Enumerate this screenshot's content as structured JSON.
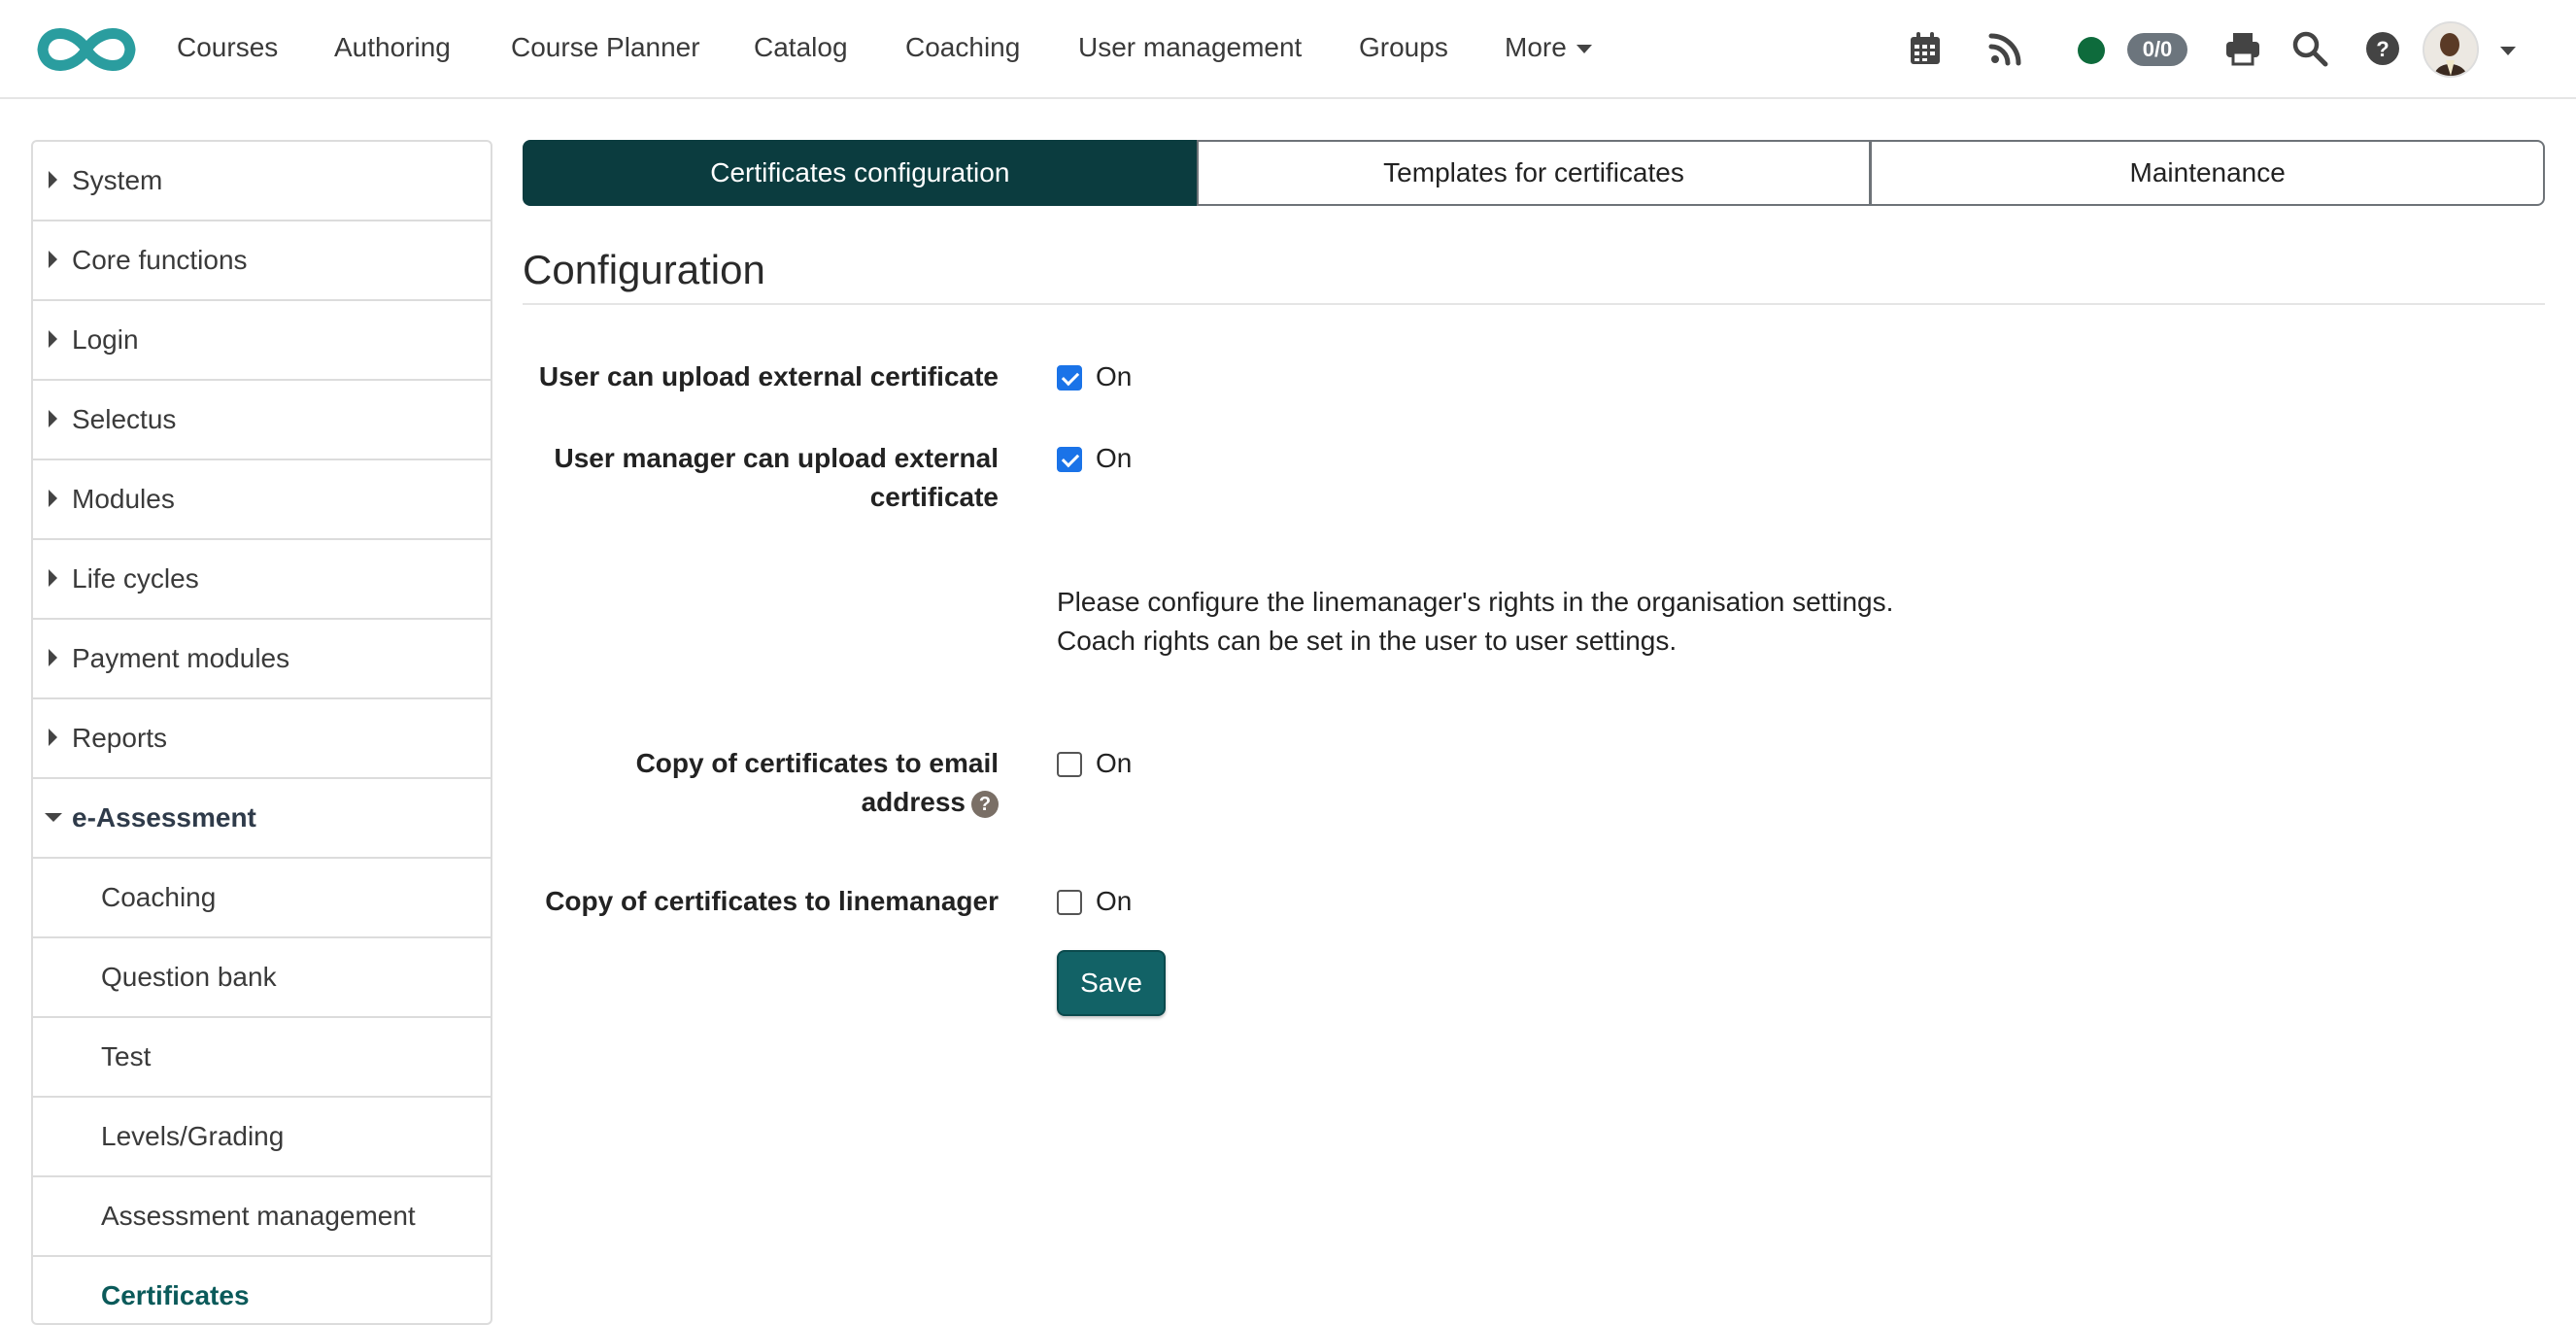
{
  "navbar": {
    "items": [
      "Courses",
      "Authoring",
      "Course Planner",
      "Catalog",
      "Coaching",
      "User management",
      "Groups",
      "More"
    ],
    "badge": "0/0",
    "icons": [
      "calendar-icon",
      "rss-icon",
      "status-dot",
      "print-icon",
      "search-icon",
      "help-icon",
      "avatar"
    ],
    "colors": {
      "logo": "#2a9d9f",
      "online": "#0e6b3c"
    }
  },
  "sidebar": {
    "items": [
      {
        "label": "System"
      },
      {
        "label": "Core functions"
      },
      {
        "label": "Login"
      },
      {
        "label": "Selectus"
      },
      {
        "label": "Modules"
      },
      {
        "label": "Life cycles"
      },
      {
        "label": "Payment modules"
      },
      {
        "label": "Reports"
      },
      {
        "label": "e-Assessment"
      }
    ],
    "subitems": [
      {
        "label": "Coaching"
      },
      {
        "label": "Question bank"
      },
      {
        "label": "Test"
      },
      {
        "label": "Levels/Grading"
      },
      {
        "label": "Assessment management"
      },
      {
        "label": "Certificates"
      }
    ]
  },
  "tabs": [
    "Certificates configuration",
    "Templates for certificates",
    "Maintenance"
  ],
  "main": {
    "heading": "Configuration",
    "fields": [
      {
        "label": "User can upload external certificate",
        "checked": true,
        "value_label": "On"
      },
      {
        "label_line1": "User manager can upload external",
        "label_line2": "certificate",
        "checked": true,
        "value_label": "On"
      },
      {
        "label_line1": "Copy of certificates to email",
        "label_line2": "address",
        "checked": false,
        "value_label": "On"
      },
      {
        "label": "Copy of certificates to linemanager",
        "checked": false,
        "value_label": "On"
      }
    ],
    "info_line1": "Please configure the linemanager's rights in the organisation settings.",
    "info_line2": "Coach rights can be set in the user to user settings.",
    "help_glyph": "?",
    "save_label": "Save"
  }
}
